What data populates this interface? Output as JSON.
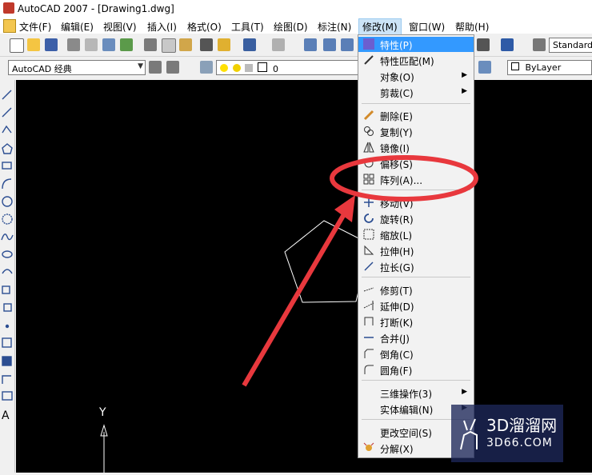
{
  "window": {
    "title": "AutoCAD 2007 - [Drawing1.dwg]"
  },
  "menubar": {
    "items": [
      "文件(F)",
      "编辑(E)",
      "视图(V)",
      "插入(I)",
      "格式(O)",
      "工具(T)",
      "绘图(D)",
      "标注(N)",
      "修改(M)",
      "窗口(W)",
      "帮助(H)"
    ]
  },
  "toolbar2": {
    "workspace": "AutoCAD 经典",
    "layer": "0",
    "text_style": "Standard",
    "color": "ByLayer"
  },
  "modify_menu": {
    "items": [
      {
        "label": "特性(P)",
        "icon": "properties-icon"
      },
      {
        "label": "特性匹配(M)",
        "icon": "brush-icon"
      },
      {
        "label": "对象(O)",
        "submenu": true
      },
      {
        "label": "剪裁(C)",
        "submenu": true
      },
      {
        "label": "删除(E)",
        "icon": "eraser-icon"
      },
      {
        "label": "复制(Y)",
        "icon": "copy-icon"
      },
      {
        "label": "镜像(I)",
        "icon": "mirror-icon"
      },
      {
        "label": "偏移(S)",
        "icon": "offset-icon"
      },
      {
        "label": "阵列(A)...",
        "icon": "array-icon"
      },
      {
        "label": "移动(V)",
        "icon": "move-icon"
      },
      {
        "label": "旋转(R)",
        "icon": "rotate-icon"
      },
      {
        "label": "缩放(L)",
        "icon": "scale-icon"
      },
      {
        "label": "拉伸(H)",
        "icon": "stretch-icon"
      },
      {
        "label": "拉长(G)",
        "icon": "lengthen-icon"
      },
      {
        "label": "修剪(T)",
        "icon": "trim-icon"
      },
      {
        "label": "延伸(D)",
        "icon": "extend-icon"
      },
      {
        "label": "打断(K)",
        "icon": "break-icon"
      },
      {
        "label": "合并(J)",
        "icon": "join-icon"
      },
      {
        "label": "倒角(C)",
        "icon": "chamfer-icon"
      },
      {
        "label": "圆角(F)",
        "icon": "fillet-icon"
      },
      {
        "label": "三维操作(3)",
        "submenu": true
      },
      {
        "label": "实体编辑(N)",
        "submenu": true
      },
      {
        "label": "更改空间(S)",
        "icon": "space-icon"
      },
      {
        "label": "分解(X)",
        "icon": "explode-icon"
      }
    ]
  },
  "canvas": {
    "ucs_label": "Y"
  },
  "watermark": {
    "line1": "3D溜溜网",
    "line2": "3D66.COM"
  },
  "colors": {
    "highlight": "#3399ff",
    "annotation_red": "#e8383d",
    "canvas": "#000000"
  }
}
